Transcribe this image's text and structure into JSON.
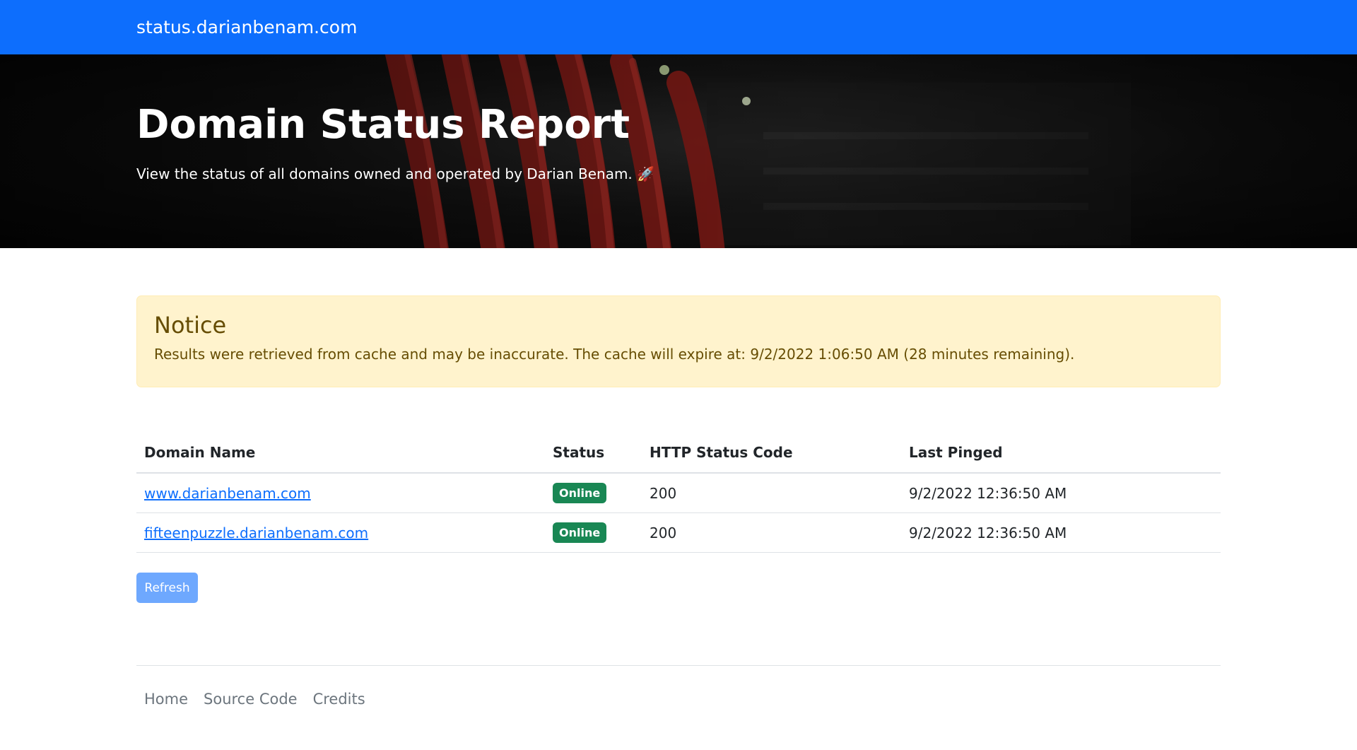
{
  "navbar": {
    "brand": "status.darianbenam.com"
  },
  "hero": {
    "title": "Domain Status Report",
    "subtitle": "View the status of all domains owned and operated by Darian Benam. 🚀"
  },
  "notice": {
    "heading": "Notice",
    "message": "Results were retrieved from cache and may be inaccurate. The cache will expire at: 9/2/2022 1:06:50 AM (28 minutes remaining)."
  },
  "table": {
    "headers": [
      "Domain Name",
      "Status",
      "HTTP Status Code",
      "Last Pinged"
    ],
    "rows": [
      {
        "domain": "www.darianbenam.com",
        "status": "Online",
        "code": "200",
        "pinged": "9/2/2022 12:36:50 AM"
      },
      {
        "domain": "fifteenpuzzle.darianbenam.com",
        "status": "Online",
        "code": "200",
        "pinged": "9/2/2022 12:36:50 AM"
      }
    ]
  },
  "refresh_label": "Refresh",
  "footer": {
    "links": [
      "Home",
      "Source Code",
      "Credits"
    ]
  },
  "colors": {
    "primary": "#0d6efd",
    "online_badge": "#198754",
    "notice_bg": "#fff3cd",
    "notice_text": "#664d03"
  }
}
